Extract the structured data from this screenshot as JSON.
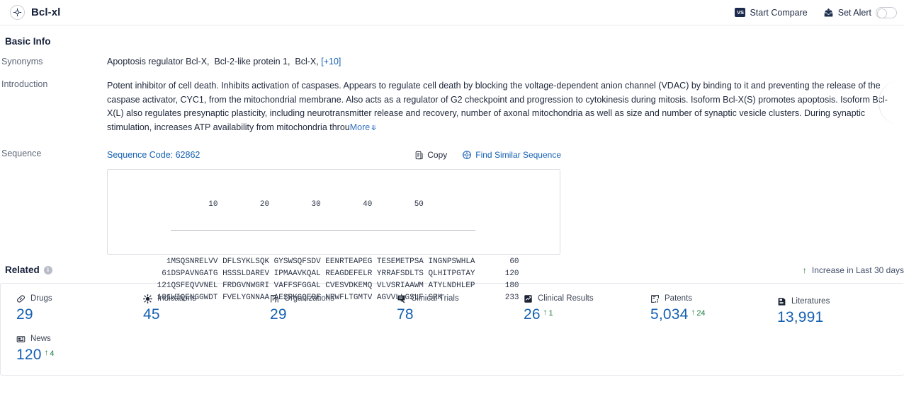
{
  "header": {
    "title": "Bcl-xl",
    "logo_icon": "target-crosshair-icon",
    "start_compare": {
      "label": "Start Compare",
      "icon": "vs-badge-icon",
      "badge_text": "VS"
    },
    "set_alert": {
      "label": "Set Alert",
      "icon": "alert-inbox-arrow-icon",
      "toggle_state": "off"
    }
  },
  "basic_info": {
    "section_title": "Basic Info",
    "synonyms": {
      "label": "Synonyms",
      "values": [
        "Apoptosis regulator Bcl-X",
        "Bcl-2-like protein 1",
        "Bcl-X"
      ],
      "more_label": "[+10]"
    },
    "introduction": {
      "label": "Introduction",
      "text": "Potent inhibitor of cell death. Inhibits activation of caspases. Appears to regulate cell death by blocking the voltage-dependent anion channel (VDAC) by binding to it and preventing the release of the caspase activator, CYC1, from the mitochondrial membrane. Also acts as a regulator of G2 checkpoint and progression to cytokinesis during mitosis. Isoform Bcl-X(S) promotes apoptosis. Isoform Bcl-X(L) also regulates presynaptic plasticity, including neurotransmitter release and recovery, number of axonal mitochondria as well as size and number of synaptic vesicle clusters. During synaptic stimulation, increases ATP availability from mitochondria throu",
      "more_label": "More",
      "more_icon": "chevron-double-down-icon"
    },
    "sequence": {
      "label": "Sequence",
      "code_label": "Sequence Code: 62862",
      "copy_label": "Copy",
      "copy_icon": "copy-icon",
      "find_similar_label": "Find Similar Sequence",
      "find_similar_icon": "find-similar-sequence-icon",
      "ruler": "        10         20         30         40         50",
      "rows": [
        {
          "start": "1",
          "blocks": "MSQSNRELVV DFLSYKLSQK GYSWSQFSDV EENRTEAPEG TESEMETPSA INGNPSWHLA",
          "end": "60"
        },
        {
          "start": "61",
          "blocks": "DSPAVNGATG HSSSLDAREV IPMAAVKQAL REAGDEFELR YRRAFSDLTS QLHITPGTAY",
          "end": "120"
        },
        {
          "start": "121",
          "blocks": "QSFEQVVNEL FRDGVNWGRI VAFFSFGGAL CVESVDKEMQ VLVSRIAAWM ATYLNDHLEP",
          "end": "180"
        },
        {
          "start": "181",
          "blocks": "WIQENGGWDT FVELYGNNAA AESRKGQERF NRWFLTGMTV AGVVLLGSLF SRK",
          "end": "233"
        }
      ]
    }
  },
  "related": {
    "section_title": "Related",
    "info_icon": "info-icon",
    "legend": {
      "label": "Increase in Last 30 days",
      "icon": "arrow-up-icon"
    },
    "stats": [
      {
        "label": "Drugs",
        "icon": "pill-icon",
        "value": "29",
        "delta": ""
      },
      {
        "label": "Indications",
        "icon": "virus-icon",
        "value": "45",
        "delta": ""
      },
      {
        "label": "Organizations",
        "icon": "building-icon",
        "value": "29",
        "delta": ""
      },
      {
        "label": "Clinical Trials",
        "icon": "clinical-trial-icon",
        "value": "78",
        "delta": ""
      },
      {
        "label": "Clinical Results",
        "icon": "clinical-result-icon",
        "value": "26",
        "delta": "1"
      },
      {
        "label": "Patents",
        "icon": "patent-icon",
        "value": "5,034",
        "delta": "24"
      },
      {
        "label": "Literatures",
        "icon": "literature-icon",
        "value": "13,991",
        "delta": ""
      },
      {
        "label": "News",
        "icon": "news-icon",
        "value": "120",
        "delta": "4"
      }
    ]
  },
  "colors": {
    "accent_blue": "#1560b2",
    "title_navy": "#16203a",
    "increase_green": "#1a7a3c"
  }
}
